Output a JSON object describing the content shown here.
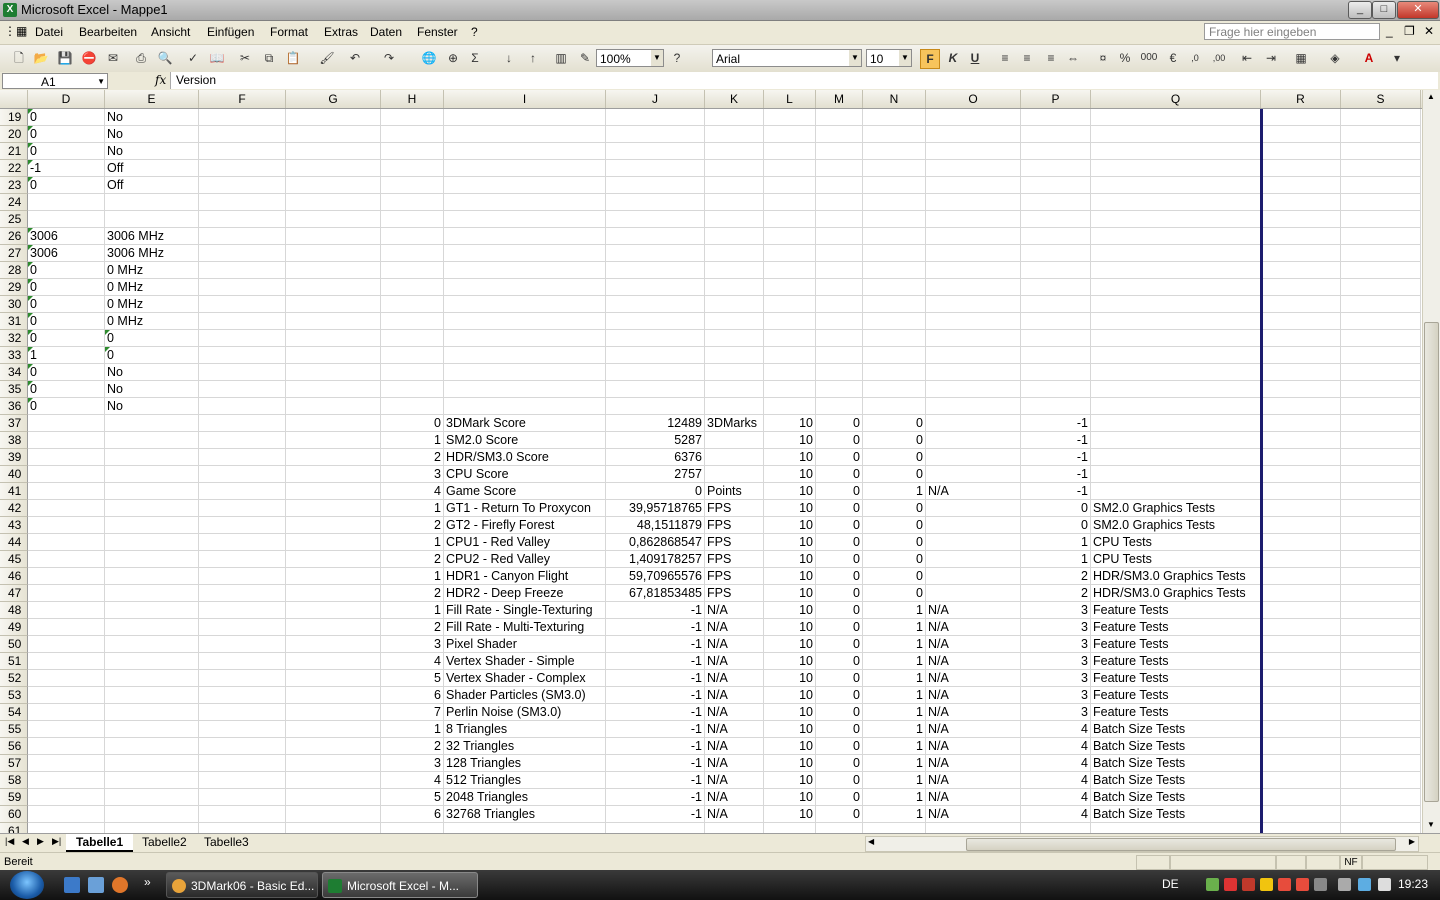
{
  "window": {
    "title": "Microsoft Excel - Mappe1",
    "app_icon": "X"
  },
  "menu": [
    "Datei",
    "Bearbeiten",
    "Ansicht",
    "Einfügen",
    "Format",
    "Extras",
    "Daten",
    "Fenster",
    "?"
  ],
  "help_box_placeholder": "Frage hier eingeben",
  "toolbar": {
    "zoom": "100%",
    "font": "Arial",
    "font_size": "10",
    "bold_label": "F",
    "italic_label": "K",
    "underline_label": "U"
  },
  "formula_bar": {
    "cell_ref": "A1",
    "fx": "fx",
    "content": "Version"
  },
  "columns": [
    "D",
    "E",
    "F",
    "G",
    "H",
    "I",
    "J",
    "K",
    "L",
    "M",
    "N",
    "O",
    "P",
    "Q",
    "R",
    "S"
  ],
  "rows": [
    {
      "n": "19",
      "D": "0",
      "E": "No"
    },
    {
      "n": "20",
      "D": "0",
      "E": "No"
    },
    {
      "n": "21",
      "D": "0",
      "E": "No"
    },
    {
      "n": "22",
      "D": "-1",
      "E": "Off"
    },
    {
      "n": "23",
      "D": "0",
      "E": "Off"
    },
    {
      "n": "24"
    },
    {
      "n": "25"
    },
    {
      "n": "26",
      "D": "3006",
      "E": "3006 MHz"
    },
    {
      "n": "27",
      "D": "3006",
      "E": "3006 MHz"
    },
    {
      "n": "28",
      "D": "0",
      "E": "0 MHz"
    },
    {
      "n": "29",
      "D": "0",
      "E": "0 MHz"
    },
    {
      "n": "30",
      "D": "0",
      "E": "0 MHz"
    },
    {
      "n": "31",
      "D": "0",
      "E": "0 MHz"
    },
    {
      "n": "32",
      "D": "0",
      "E": "0"
    },
    {
      "n": "33",
      "D": "1",
      "E": "0"
    },
    {
      "n": "34",
      "D": "0",
      "E": "No"
    },
    {
      "n": "35",
      "D": "0",
      "E": "No"
    },
    {
      "n": "36",
      "D": "0",
      "E": "No"
    },
    {
      "n": "37",
      "H": "0",
      "I": "3DMark Score",
      "J": "12489",
      "K": "3DMarks",
      "L": "10",
      "M": "0",
      "N": "0",
      "O": "",
      "P": "-1",
      "Q": ""
    },
    {
      "n": "38",
      "H": "1",
      "I": "SM2.0 Score",
      "J": "5287",
      "K": "",
      "L": "10",
      "M": "0",
      "N": "0",
      "O": "",
      "P": "-1",
      "Q": ""
    },
    {
      "n": "39",
      "H": "2",
      "I": "HDR/SM3.0 Score",
      "J": "6376",
      "K": "",
      "L": "10",
      "M": "0",
      "N": "0",
      "O": "",
      "P": "-1",
      "Q": ""
    },
    {
      "n": "40",
      "H": "3",
      "I": "CPU Score",
      "J": "2757",
      "K": "",
      "L": "10",
      "M": "0",
      "N": "0",
      "O": "",
      "P": "-1",
      "Q": ""
    },
    {
      "n": "41",
      "H": "4",
      "I": "Game Score",
      "J": "0",
      "K": "Points",
      "L": "10",
      "M": "0",
      "N": "1",
      "O": "N/A",
      "P": "-1",
      "Q": ""
    },
    {
      "n": "42",
      "H": "1",
      "I": "GT1 - Return To Proxycon",
      "J": "39,95718765",
      "K": "FPS",
      "L": "10",
      "M": "0",
      "N": "0",
      "O": "",
      "P": "0",
      "Q": "SM2.0 Graphics Tests"
    },
    {
      "n": "43",
      "H": "2",
      "I": "GT2 - Firefly Forest",
      "J": "48,1511879",
      "K": "FPS",
      "L": "10",
      "M": "0",
      "N": "0",
      "O": "",
      "P": "0",
      "Q": "SM2.0 Graphics Tests"
    },
    {
      "n": "44",
      "H": "1",
      "I": "CPU1 - Red Valley",
      "J": "0,862868547",
      "K": "FPS",
      "L": "10",
      "M": "0",
      "N": "0",
      "O": "",
      "P": "1",
      "Q": "CPU Tests"
    },
    {
      "n": "45",
      "H": "2",
      "I": "CPU2 - Red Valley",
      "J": "1,409178257",
      "K": "FPS",
      "L": "10",
      "M": "0",
      "N": "0",
      "O": "",
      "P": "1",
      "Q": "CPU Tests"
    },
    {
      "n": "46",
      "H": "1",
      "I": "HDR1 - Canyon Flight",
      "J": "59,70965576",
      "K": "FPS",
      "L": "10",
      "M": "0",
      "N": "0",
      "O": "",
      "P": "2",
      "Q": "HDR/SM3.0 Graphics Tests"
    },
    {
      "n": "47",
      "H": "2",
      "I": "HDR2 - Deep Freeze",
      "J": "67,81853485",
      "K": "FPS",
      "L": "10",
      "M": "0",
      "N": "0",
      "O": "",
      "P": "2",
      "Q": "HDR/SM3.0 Graphics Tests"
    },
    {
      "n": "48",
      "H": "1",
      "I": "Fill Rate - Single-Texturing",
      "J": "-1",
      "K": "N/A",
      "L": "10",
      "M": "0",
      "N": "1",
      "O": "N/A",
      "P": "3",
      "Q": "Feature Tests"
    },
    {
      "n": "49",
      "H": "2",
      "I": "Fill Rate - Multi-Texturing",
      "J": "-1",
      "K": "N/A",
      "L": "10",
      "M": "0",
      "N": "1",
      "O": "N/A",
      "P": "3",
      "Q": "Feature Tests"
    },
    {
      "n": "50",
      "H": "3",
      "I": "Pixel Shader",
      "J": "-1",
      "K": "N/A",
      "L": "10",
      "M": "0",
      "N": "1",
      "O": "N/A",
      "P": "3",
      "Q": "Feature Tests"
    },
    {
      "n": "51",
      "H": "4",
      "I": "Vertex Shader - Simple",
      "J": "-1",
      "K": "N/A",
      "L": "10",
      "M": "0",
      "N": "1",
      "O": "N/A",
      "P": "3",
      "Q": "Feature Tests"
    },
    {
      "n": "52",
      "H": "5",
      "I": "Vertex Shader - Complex",
      "J": "-1",
      "K": "N/A",
      "L": "10",
      "M": "0",
      "N": "1",
      "O": "N/A",
      "P": "3",
      "Q": "Feature Tests"
    },
    {
      "n": "53",
      "H": "6",
      "I": "Shader Particles (SM3.0)",
      "J": "-1",
      "K": "N/A",
      "L": "10",
      "M": "0",
      "N": "1",
      "O": "N/A",
      "P": "3",
      "Q": "Feature Tests"
    },
    {
      "n": "54",
      "H": "7",
      "I": "Perlin Noise (SM3.0)",
      "J": "-1",
      "K": "N/A",
      "L": "10",
      "M": "0",
      "N": "1",
      "O": "N/A",
      "P": "3",
      "Q": "Feature Tests"
    },
    {
      "n": "55",
      "H": "1",
      "I": "8 Triangles",
      "J": "-1",
      "K": "N/A",
      "L": "10",
      "M": "0",
      "N": "1",
      "O": "N/A",
      "P": "4",
      "Q": "Batch Size Tests"
    },
    {
      "n": "56",
      "H": "2",
      "I": "32 Triangles",
      "J": "-1",
      "K": "N/A",
      "L": "10",
      "M": "0",
      "N": "1",
      "O": "N/A",
      "P": "4",
      "Q": "Batch Size Tests"
    },
    {
      "n": "57",
      "H": "3",
      "I": "128 Triangles",
      "J": "-1",
      "K": "N/A",
      "L": "10",
      "M": "0",
      "N": "1",
      "O": "N/A",
      "P": "4",
      "Q": "Batch Size Tests"
    },
    {
      "n": "58",
      "H": "4",
      "I": "512 Triangles",
      "J": "-1",
      "K": "N/A",
      "L": "10",
      "M": "0",
      "N": "1",
      "O": "N/A",
      "P": "4",
      "Q": "Batch Size Tests"
    },
    {
      "n": "59",
      "H": "5",
      "I": "2048 Triangles",
      "J": "-1",
      "K": "N/A",
      "L": "10",
      "M": "0",
      "N": "1",
      "O": "N/A",
      "P": "4",
      "Q": "Batch Size Tests"
    },
    {
      "n": "60",
      "H": "6",
      "I": "32768 Triangles",
      "J": "-1",
      "K": "N/A",
      "L": "10",
      "M": "0",
      "N": "1",
      "O": "N/A",
      "P": "4",
      "Q": "Batch Size Tests"
    },
    {
      "n": "61"
    }
  ],
  "sheet_tabs": [
    "Tabelle1",
    "Tabelle2",
    "Tabelle3"
  ],
  "status": {
    "ready": "Bereit",
    "nf": "NF"
  },
  "taskbar": {
    "buttons": [
      {
        "label": "3DMark06 - Basic Ed..."
      },
      {
        "label": "Microsoft Excel - M..."
      }
    ],
    "lang": "DE",
    "clock": "19:23"
  },
  "colors": {
    "accent": "#f7c45c",
    "freeze_line": "#1c1c6e",
    "text_triangle": "#2e8b2e"
  }
}
